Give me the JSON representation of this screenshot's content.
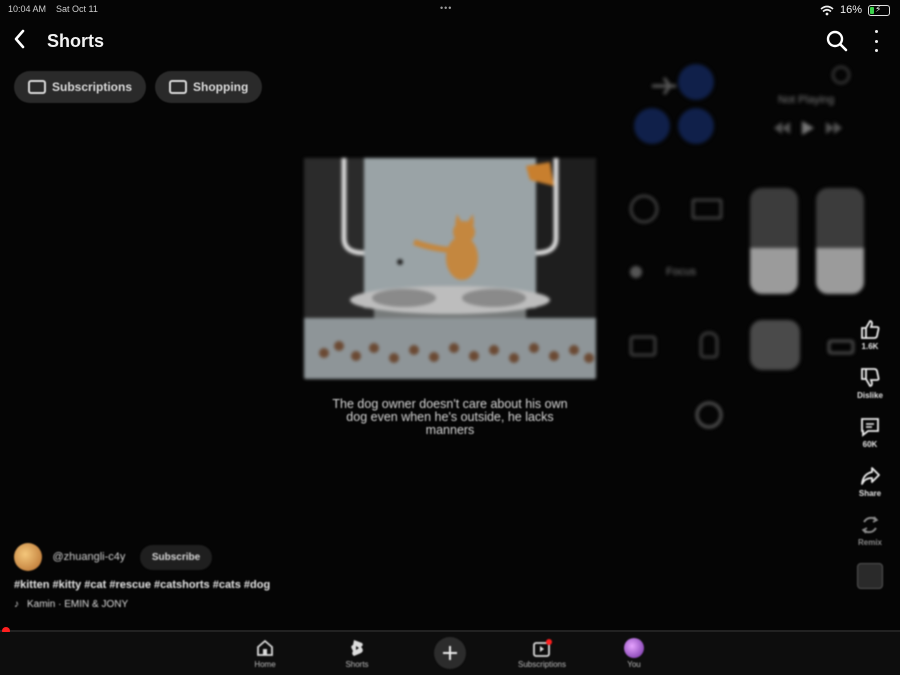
{
  "status": {
    "time": "10:04 AM",
    "date": "Sat Oct 11",
    "battery": "16%",
    "dots": "•••"
  },
  "header": {
    "title": "Shorts"
  },
  "chips": [
    {
      "label": "Subscriptions",
      "icon": "subscriptions-icon"
    },
    {
      "label": "Shopping",
      "icon": "shopping-bag-icon"
    }
  ],
  "video": {
    "caption": "The dog owner doesn't care about his own dog even when he's outside, he lacks manners"
  },
  "control_center": {
    "media_status": "Not Playing",
    "focus_label": "Focus"
  },
  "actions": {
    "like_count": "1.6K",
    "dislike_label": "Dislike",
    "comments_count": "60K",
    "share_label": "Share",
    "remix_label": "Remix"
  },
  "channel": {
    "handle": "@zhuangli-c4y",
    "subscribe_label": "Subscribe"
  },
  "hashtags": "#kitten #kitty #cat #rescue #catshorts #cats #dog",
  "sound": "Kamin · EMIN & JONY",
  "nav": {
    "home": "Home",
    "shorts": "Shorts",
    "subscriptions": "Subscriptions",
    "you": "You"
  },
  "colors": {
    "accent": "#ff1f1f",
    "battery": "#3bd34b",
    "cc_blue": "#1e3a8a"
  }
}
